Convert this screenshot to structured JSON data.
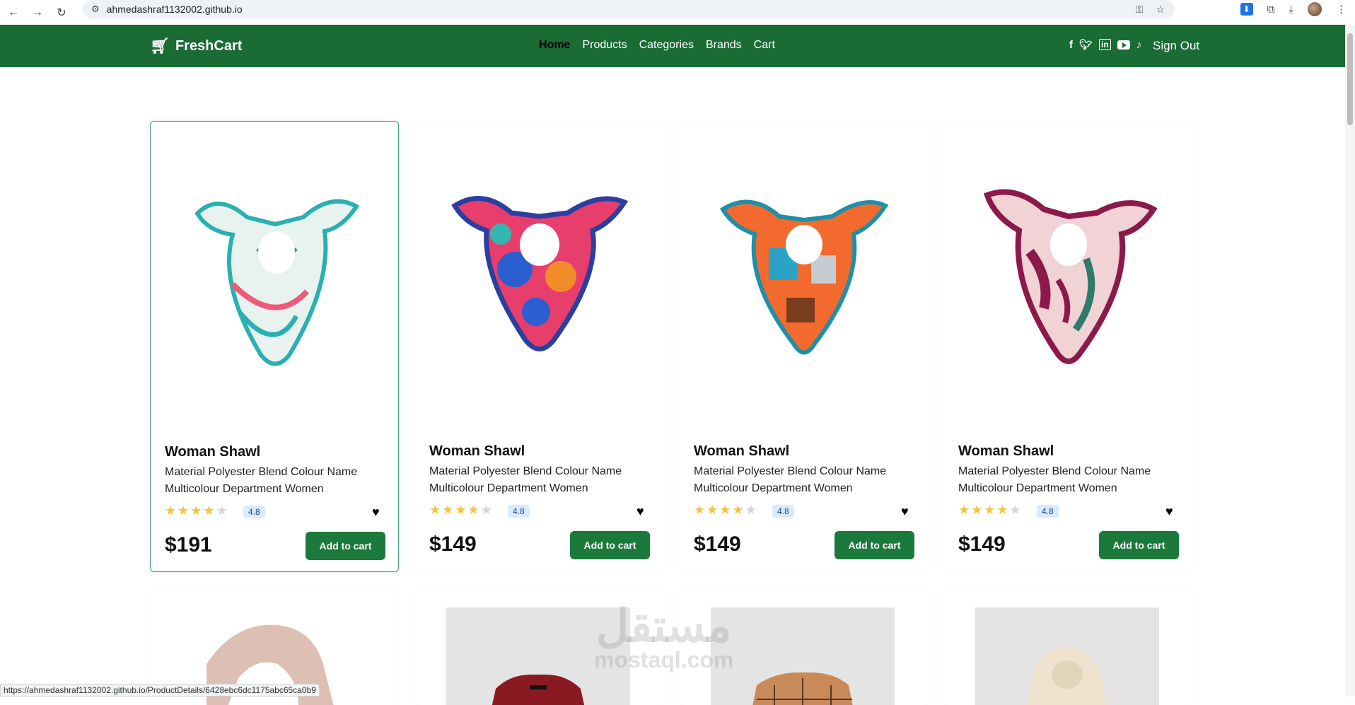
{
  "browser": {
    "url": "ahmedashraf1132002.github.io",
    "status_url": "https://ahmedashraf1132002.github.io/ProductDetails/6428ebc6dc1175abc65ca0b9"
  },
  "navbar": {
    "brand": "FreshCart",
    "menu": [
      "Home",
      "Products",
      "Categories",
      "Brands",
      "Cart"
    ],
    "active": "Home",
    "signout": "Sign Out",
    "bg_color": "#1b6b35"
  },
  "products": [
    {
      "title": "Woman Shawl",
      "desc": "Material Polyester Blend Colour Name Multicolour Department Women",
      "rating": "4.8",
      "stars": 4,
      "price": "$191",
      "button": "Add to cart"
    },
    {
      "title": "Woman Shawl",
      "desc": "Material Polyester Blend Colour Name Multicolour Department Women",
      "rating": "4.8",
      "stars": 4,
      "price": "$149",
      "button": "Add to cart"
    },
    {
      "title": "Woman Shawl",
      "desc": "Material Polyester Blend Colour Name Multicolour Department Women",
      "rating": "4.8",
      "stars": 4,
      "price": "$149",
      "button": "Add to cart"
    },
    {
      "title": "Woman Shawl",
      "desc": "Material Polyester Blend Colour Name Multicolour Department Women",
      "rating": "4.8",
      "stars": 4,
      "price": "$149",
      "button": "Add to cart"
    }
  ],
  "watermark": {
    "arabic": "مستقل",
    "latin": "mostaql.com"
  }
}
